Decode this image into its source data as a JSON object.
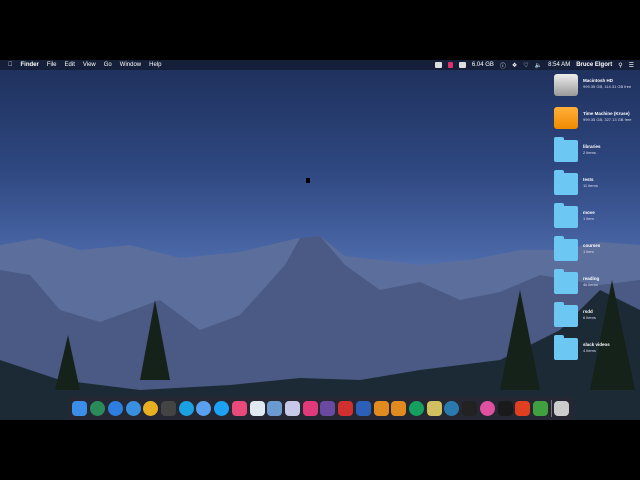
{
  "menubar": {
    "app": "Finder",
    "items": [
      "File",
      "Edit",
      "View",
      "Go",
      "Window",
      "Help"
    ],
    "storage": "6.04 GB",
    "time": "8:54 AM",
    "user": "Bruce Elgort"
  },
  "desktop_items": [
    {
      "name": "Macintosh HD",
      "sub": "999.35 GB, 114.31 GB free",
      "type": "drive"
    },
    {
      "name": "Time Machine (Kruse)",
      "sub": "999.35 GB, 327.13 GB free",
      "type": "timemachine"
    },
    {
      "name": "libraries",
      "sub": "2 items",
      "type": "folder"
    },
    {
      "name": "tests",
      "sub": "11 items",
      "type": "folder"
    },
    {
      "name": "move",
      "sub": "1 item",
      "type": "folder"
    },
    {
      "name": "courses",
      "sub": "1 item",
      "type": "folder"
    },
    {
      "name": "reading",
      "sub": "4k items",
      "type": "folder"
    },
    {
      "name": "rsdd",
      "sub": "6 items",
      "type": "folder"
    },
    {
      "name": "slack videos",
      "sub": "4 items",
      "type": "folder"
    }
  ],
  "dock": [
    {
      "name": "finder",
      "color": "#3a8ee8"
    },
    {
      "name": "time-machine",
      "color": "#2a8a5a"
    },
    {
      "name": "app-store",
      "color": "#2d7ee0"
    },
    {
      "name": "safari",
      "color": "#3a90e0"
    },
    {
      "name": "chrome",
      "color": "#e8b020"
    },
    {
      "name": "dashboard",
      "color": "#444"
    },
    {
      "name": "skype",
      "color": "#1ba1e2"
    },
    {
      "name": "messages",
      "color": "#5aa0f0"
    },
    {
      "name": "twitter",
      "color": "#1da1f2"
    },
    {
      "name": "slack",
      "color": "#e84a7a"
    },
    {
      "name": "diagram",
      "color": "#e0e8f0"
    },
    {
      "name": "preview",
      "color": "#6a9ad0"
    },
    {
      "name": "photo-booth",
      "color": "#c8c8e8"
    },
    {
      "name": "display",
      "color": "#e03a7a"
    },
    {
      "name": "github",
      "color": "#6a4aa0"
    },
    {
      "name": "word-pdf",
      "color": "#d03030"
    },
    {
      "name": "word",
      "color": "#2b5fb8"
    },
    {
      "name": "sublime-1",
      "color": "#e08a20"
    },
    {
      "name": "sublime-2",
      "color": "#e08a20"
    },
    {
      "name": "grammarly",
      "color": "#15a060"
    },
    {
      "name": "archive",
      "color": "#d0c060"
    },
    {
      "name": "wordpress",
      "color": "#2a7ab0"
    },
    {
      "name": "sonos",
      "color": "#222"
    },
    {
      "name": "itunes",
      "color": "#e050a0"
    },
    {
      "name": "terminal",
      "color": "#1a1a1a"
    },
    {
      "name": "office",
      "color": "#e04020"
    },
    {
      "name": "camtasia",
      "color": "#40a040"
    },
    {
      "name": "trash",
      "color": "#ccc"
    }
  ]
}
